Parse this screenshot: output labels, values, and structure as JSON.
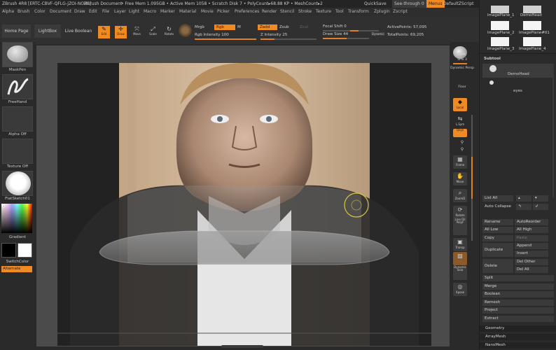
{
  "titlebar": {
    "app": "ZBrush 4R8 [ERTC-CBVF-QFLG-JZOI-NOHL]",
    "document": "ZBrush Document",
    "status": "• Free Mem 1.095GB • Active Mem 1058 • Scratch Disk 7 • PolyCount▸68.88 KP • MeshCount▸2",
    "quicksave": "QuickSave",
    "seethrough": "See-through 0",
    "menus": "Menus",
    "zscript": "DefaultZScript"
  },
  "menubar": [
    "Alpha",
    "Brush",
    "Color",
    "Document",
    "Draw",
    "Edit",
    "File",
    "Layer",
    "Light",
    "Macro",
    "Marker",
    "Material",
    "Movie",
    "Picker",
    "Preferences",
    "Render",
    "Stencil",
    "Stroke",
    "Texture",
    "Tool",
    "Transform",
    "Zplugin",
    "Zscript"
  ],
  "toolbar": {
    "home": "Home Page",
    "lightbox": "LightBox",
    "liveboolean": "Live Boolean",
    "tools": [
      "Edit",
      "Draw",
      "Move",
      "Scale",
      "Rotate"
    ],
    "mrgb": "Mrgb",
    "rgb": "Rgb",
    "m": "M",
    "zadd": "Zadd",
    "zsub": "Zsub",
    "zcut": "Zcut",
    "rgb_intensity": "Rgb Intensity 100",
    "rgb_intensity_level": 100,
    "z_intensity": "Z Intensity 25",
    "z_intensity_level": 25,
    "focal_shift": "Focal Shift 0",
    "draw_size": "Draw Size 44",
    "dynamic": "Dynamic",
    "active_points": "ActivePoints: 57,095",
    "total_points": "TotalPoints: 69,205"
  },
  "leftshelf": {
    "brush": "MaskPen",
    "stroke": "FreeHand",
    "alpha": "Alpha Off",
    "texture": "Texture Off",
    "material": "FlatSketch01",
    "gradient": "Gradient",
    "switchcolor": "SwitchColor",
    "alternate": "Alternate"
  },
  "rightshelf": {
    "bpr": "BPR",
    "spix": "SPix 3",
    "items": [
      "Dynamic Persp",
      "Floor",
      "Local",
      "L.Sym",
      "Qxyz",
      "",
      "",
      "Frame",
      "Move",
      "ZoomD",
      "Rotate",
      "Line Fill PolyF",
      "Transp",
      "Dynamic Solo",
      "Xpose"
    ]
  },
  "tray": {
    "imageplanes": [
      "ImagePlane_1",
      "DemoHead",
      "ImagePlane_2",
      "ImagePlane#01",
      "ImagePlane_3",
      "ImagePlane_4"
    ],
    "subtool_title": "Subtool",
    "subtools": [
      "DemoHead",
      "eyes"
    ],
    "buttons": {
      "list_all": "List All",
      "auto_collapse": "Auto Collapse",
      "rename": "Rename",
      "autoreorder": "AutoReorder",
      "all_low": "All Low",
      "all_high": "All High",
      "copy": "Copy",
      "paste": "Paste",
      "duplicate": "Duplicate",
      "append": "Append",
      "insert": "Insert",
      "delete": "Delete",
      "del_other": "Del Other",
      "del_all": "Del All",
      "split": "Split",
      "merge": "Merge",
      "boolean": "Boolean",
      "remesh": "Remesh",
      "project": "Project",
      "extract": "Extract",
      "geometry": "Geometry",
      "arraymesh": "ArrayMesh",
      "nanomesh": "NanoMesh"
    }
  },
  "colors": {
    "accent": "#f08a23",
    "panel": "#2b2b2b",
    "button": "#3a3a3a"
  }
}
